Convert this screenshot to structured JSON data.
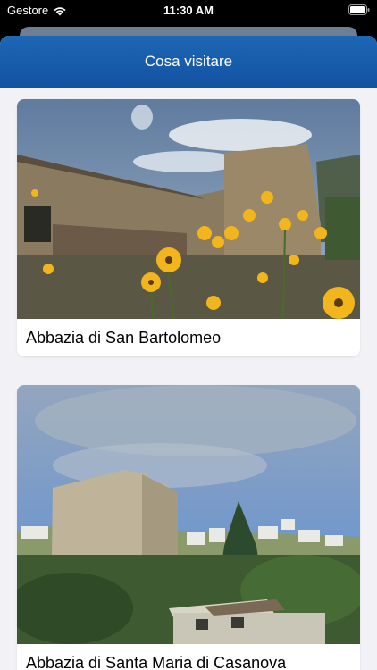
{
  "status_bar": {
    "carrier": "Gestore",
    "time": "11:30 AM"
  },
  "nav": {
    "title": "Cosa visitare"
  },
  "places": [
    {
      "name": "Abbazia di San Bartolomeo"
    },
    {
      "name": "Abbazia di Santa Maria di Casanova"
    }
  ],
  "colors": {
    "nav_bar": "#1a5fae",
    "background": "#f1f1f6"
  }
}
